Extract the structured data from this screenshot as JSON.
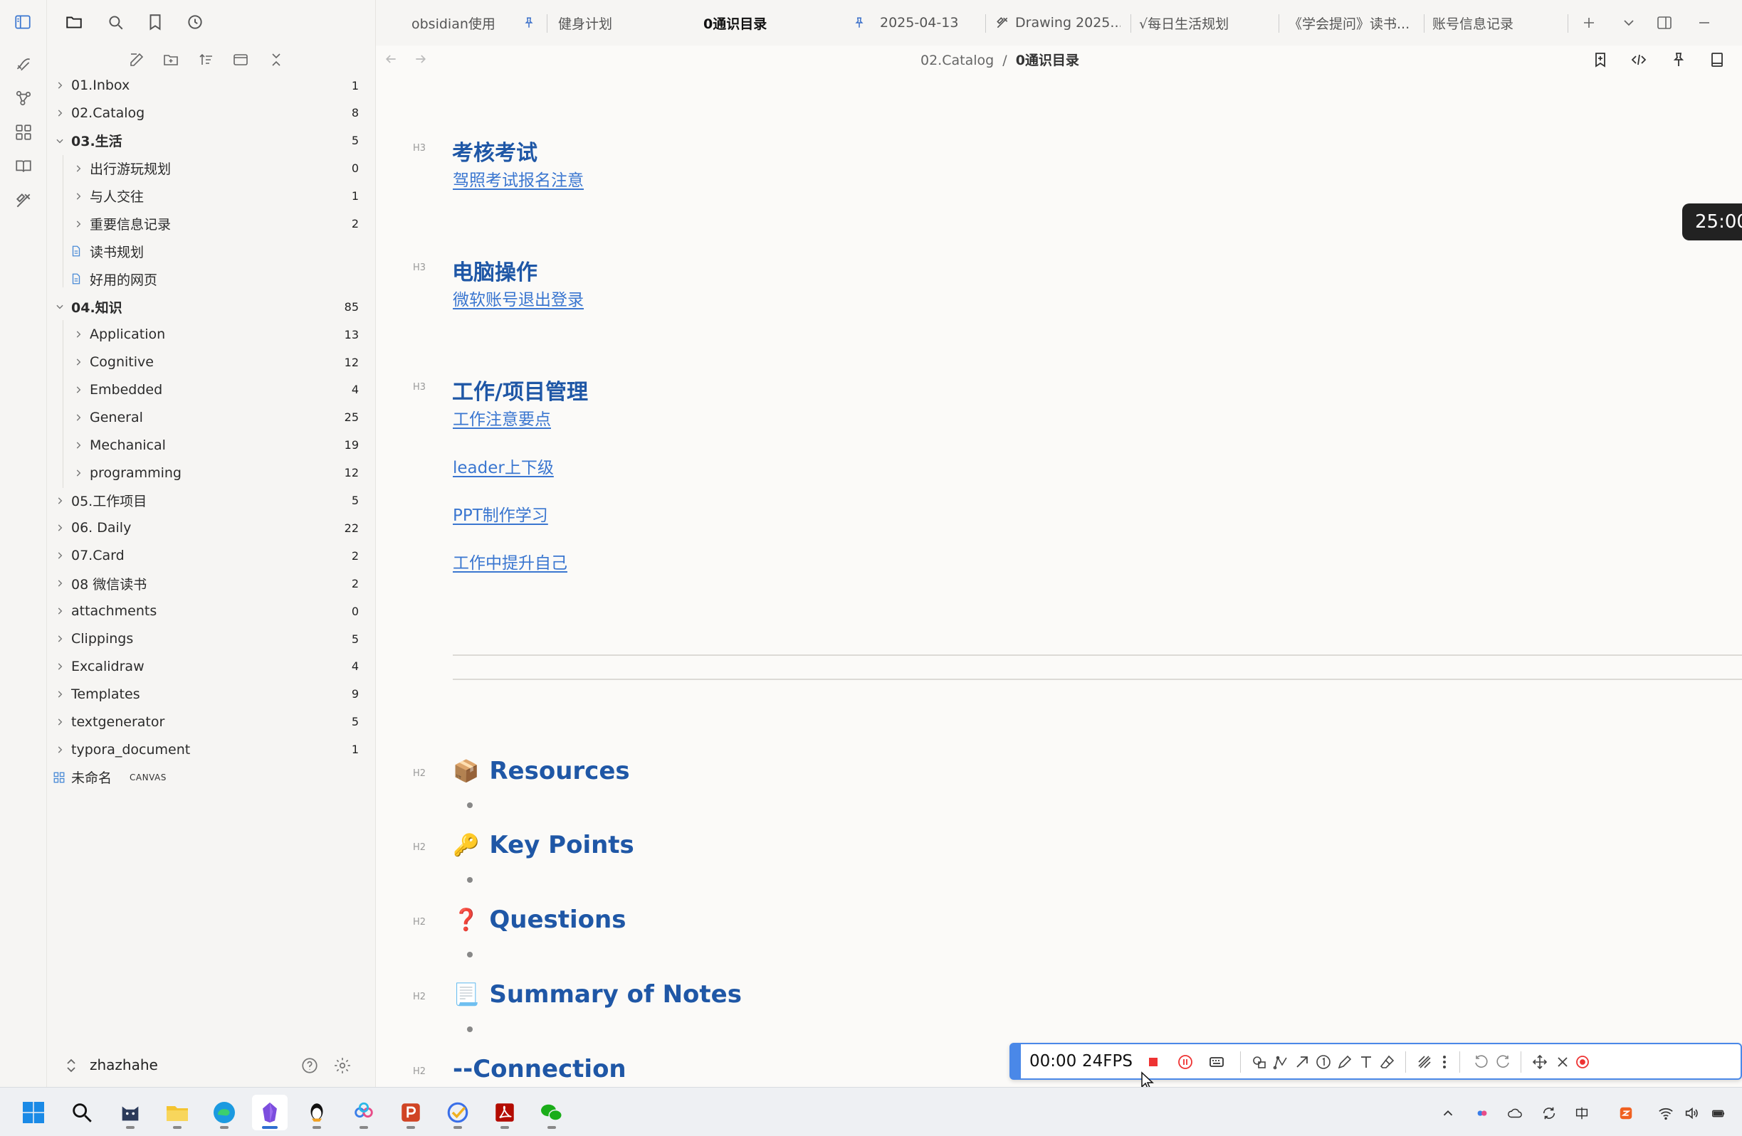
{
  "tabs": [
    {
      "label": "obsidian使用",
      "pinned": true
    },
    {
      "label": "健身计划",
      "pinned": false
    },
    {
      "label": "0通识目录",
      "pinned": true,
      "active": true
    },
    {
      "label": "2025-04-13",
      "pinned": false
    },
    {
      "label": "Drawing 2025...",
      "pinned": false
    },
    {
      "label": "√每日生活规划",
      "pinned": false
    },
    {
      "label": "《学会提问》读书...",
      "pinned": false
    },
    {
      "label": "账号信息记录",
      "pinned": false
    }
  ],
  "breadcrumb": {
    "parent": "02.Catalog",
    "separator": "/",
    "current": "0通识目录"
  },
  "tree": [
    {
      "label": "01.Inbox",
      "count": "1",
      "level": 0,
      "type": "folder",
      "expanded": false
    },
    {
      "label": "02.Catalog",
      "count": "8",
      "level": 0,
      "type": "folder",
      "expanded": false
    },
    {
      "label": "03.生活",
      "count": "5",
      "level": 0,
      "type": "folder",
      "expanded": true
    },
    {
      "label": "出行游玩规划",
      "count": "0",
      "level": 1,
      "type": "folder",
      "expanded": false
    },
    {
      "label": "与人交往",
      "count": "1",
      "level": 1,
      "type": "folder",
      "expanded": false
    },
    {
      "label": "重要信息记录",
      "count": "2",
      "level": 1,
      "type": "folder",
      "expanded": false
    },
    {
      "label": "读书规划",
      "count": "",
      "level": 1,
      "type": "file"
    },
    {
      "label": "好用的网页",
      "count": "",
      "level": 1,
      "type": "file"
    },
    {
      "label": "04.知识",
      "count": "85",
      "level": 0,
      "type": "folder",
      "expanded": true
    },
    {
      "label": "Application",
      "count": "13",
      "level": 1,
      "type": "folder",
      "expanded": false
    },
    {
      "label": "Cognitive",
      "count": "12",
      "level": 1,
      "type": "folder",
      "expanded": false
    },
    {
      "label": "Embedded",
      "count": "4",
      "level": 1,
      "type": "folder",
      "expanded": false
    },
    {
      "label": "General",
      "count": "25",
      "level": 1,
      "type": "folder",
      "expanded": false
    },
    {
      "label": "Mechanical",
      "count": "19",
      "level": 1,
      "type": "folder",
      "expanded": false
    },
    {
      "label": "programming",
      "count": "12",
      "level": 1,
      "type": "folder",
      "expanded": false
    },
    {
      "label": "05.工作项目",
      "count": "5",
      "level": 0,
      "type": "folder",
      "expanded": false
    },
    {
      "label": "06. Daily",
      "count": "22",
      "level": 0,
      "type": "folder",
      "expanded": false
    },
    {
      "label": "07.Card",
      "count": "2",
      "level": 0,
      "type": "folder",
      "expanded": false
    },
    {
      "label": "08 微信读书",
      "count": "2",
      "level": 0,
      "type": "folder",
      "expanded": false
    },
    {
      "label": "attachments",
      "count": "0",
      "level": 0,
      "type": "folder",
      "expanded": false
    },
    {
      "label": "Clippings",
      "count": "5",
      "level": 0,
      "type": "folder",
      "expanded": false
    },
    {
      "label": "Excalidraw",
      "count": "4",
      "level": 0,
      "type": "folder",
      "expanded": false
    },
    {
      "label": "Templates",
      "count": "9",
      "level": 0,
      "type": "folder",
      "expanded": false
    },
    {
      "label": "textgenerator",
      "count": "5",
      "level": 0,
      "type": "folder",
      "expanded": false
    },
    {
      "label": "typora_document",
      "count": "1",
      "level": 0,
      "type": "folder",
      "expanded": false
    },
    {
      "label": "未命名",
      "count": "",
      "level": 0,
      "type": "canvas",
      "badge": "CANVAS"
    }
  ],
  "user": {
    "name": "zhazhahe"
  },
  "content": {
    "h3_label": "H3",
    "h2_label": "H2",
    "sections": [
      {
        "title": "考核考试",
        "links": [
          "驾照考试报名注意"
        ]
      },
      {
        "title": "电脑操作",
        "links": [
          "微软账号退出登录"
        ]
      },
      {
        "title": "工作/项目管理",
        "links": [
          "工作注意要点",
          "leader上下级",
          "PPT制作学习",
          "工作中提升自己"
        ]
      }
    ],
    "h2_sections": [
      {
        "emoji": "📦",
        "title": "Resources"
      },
      {
        "emoji": "🔑",
        "title": "Key Points"
      },
      {
        "emoji": "❓",
        "title": "Questions"
      },
      {
        "emoji": "📃",
        "title": "Summary of Notes"
      },
      {
        "emoji": "",
        "title": "--Connection"
      }
    ]
  },
  "timer": "25:00",
  "recorder": {
    "time": "00:00",
    "fps": "24FPS"
  },
  "colors": {
    "heading": "#1f57a6",
    "link": "#3a76d0",
    "accent": "#4a88e8"
  }
}
